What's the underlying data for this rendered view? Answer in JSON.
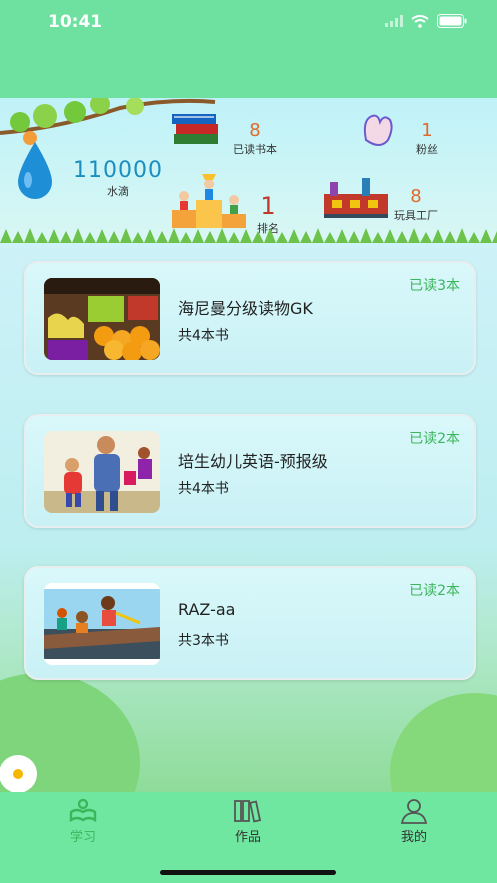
{
  "status": {
    "time": "10:41"
  },
  "stats": {
    "water": {
      "value": "110000",
      "label": "水滴"
    },
    "books_read": {
      "value": "8",
      "label": "已读书本"
    },
    "fans": {
      "value": "1",
      "label": "粉丝"
    },
    "rank": {
      "value": "1",
      "label": "排名"
    },
    "factory": {
      "value": "8",
      "label": "玩具工厂"
    }
  },
  "series": [
    {
      "title": "海尼曼分级读物GK",
      "count": "共4本书",
      "read": "已读3本"
    },
    {
      "title": "培生幼儿英语-预报级",
      "count": "共4本书",
      "read": "已读2本"
    },
    {
      "title": "RAZ-aa",
      "count": "共3本书",
      "read": "已读2本"
    }
  ],
  "tabbar": {
    "study": "学习",
    "works": "作品",
    "mine": "我的"
  },
  "colors": {
    "accent_green": "#3bb65b",
    "tabbar": "#70e7a1",
    "number_orange": "#e06a2a"
  }
}
